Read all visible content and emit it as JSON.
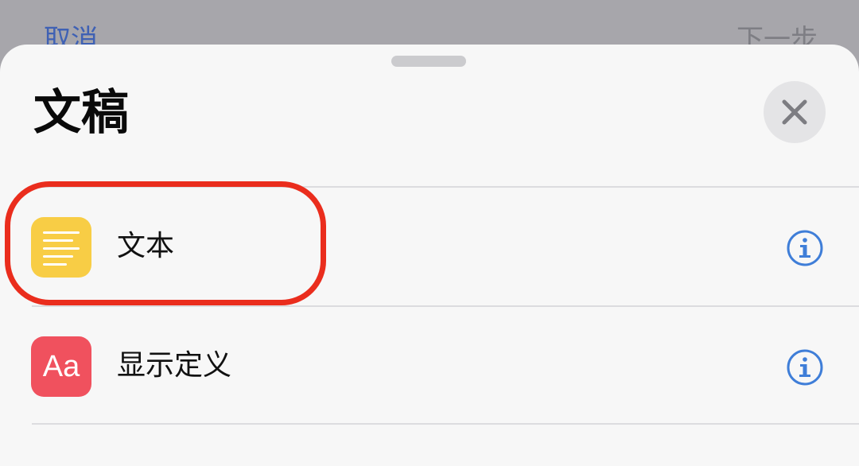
{
  "background": {
    "cancel_label": "取消",
    "next_label": "下一步"
  },
  "sheet": {
    "title": "文稿",
    "items": [
      {
        "label": "文本",
        "icon": "notes-lines-icon",
        "icon_color": "#f8cd45"
      },
      {
        "label": "显示定义",
        "icon": "dictionary-icon",
        "icon_glyph": "Aa",
        "icon_color": "#f0515e"
      }
    ]
  },
  "colors": {
    "highlight": "#ea2d1d",
    "accent": "#3f7ed8"
  }
}
